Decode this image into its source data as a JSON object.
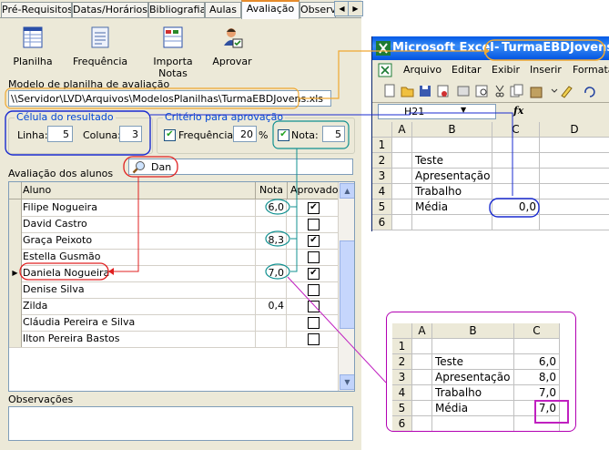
{
  "tabs": [
    "Pré-Requisitos",
    "Datas/Horários",
    "Bibliografia",
    "Aulas",
    "Avaliação",
    "Observ"
  ],
  "active_tab": "Avaliação",
  "toolbar": {
    "planilha": "Planilha",
    "frequencia": "Frequência",
    "importa_notas": "Importa Notas",
    "aprovar": "Aprovar"
  },
  "modelo": {
    "label": "Modelo de planilha de avaliação",
    "path": "\\\\Servidor\\LVD\\Arquivos\\ModelosPlanilhas\\TurmaEBDJovens.xls"
  },
  "celula": {
    "title": "Célula do resultado",
    "linha_label": "Linha:",
    "linha_value": "5",
    "coluna_label": "Coluna:",
    "coluna_value": "3"
  },
  "criterio": {
    "title": "Critério para aprovação",
    "frequencia_label": "Frequência:",
    "frequencia_value": "20",
    "percent": "%",
    "nota_label": "Nota:",
    "nota_value": "5"
  },
  "avaliacao": {
    "label": "Avaliação dos alunos",
    "search": "Dan",
    "headers": {
      "aluno": "Aluno",
      "nota": "Nota",
      "aprovado": "Aprovado"
    },
    "rows": [
      {
        "aluno": "Filipe Nogueira",
        "nota": "6,0",
        "aprovado": true
      },
      {
        "aluno": "David Castro",
        "nota": "",
        "aprovado": false
      },
      {
        "aluno": "Graça Peixoto",
        "nota": "8,3",
        "aprovado": true
      },
      {
        "aluno": "Estella Gusmão",
        "nota": "",
        "aprovado": false
      },
      {
        "aluno": "Daniela Nogueira",
        "nota": "7,0",
        "aprovado": true
      },
      {
        "aluno": "Denise Silva",
        "nota": "",
        "aprovado": false
      },
      {
        "aluno": "Zilda",
        "nota": "0,4",
        "aprovado": false
      },
      {
        "aluno": "Cláudia Pereira e Silva",
        "nota": "",
        "aprovado": false
      },
      {
        "aluno": "Ilton Pereira Bastos",
        "nota": "",
        "aprovado": false
      }
    ]
  },
  "observacoes": {
    "label": "Observações",
    "value": ""
  },
  "excel": {
    "app": "Microsoft Excel",
    "file": "TurmaEBDJovens.xls",
    "menu": [
      "Arquivo",
      "Editar",
      "Exibir",
      "Inserir",
      "Formata"
    ],
    "name_box": "H21",
    "fx": "fx",
    "columns": [
      "A",
      "B",
      "C",
      "D"
    ],
    "rows": [
      {
        "n": "1",
        "b": "",
        "c": ""
      },
      {
        "n": "2",
        "b": "Teste",
        "c": ""
      },
      {
        "n": "3",
        "b": "Apresentação",
        "c": ""
      },
      {
        "n": "4",
        "b": "Trabalho",
        "c": ""
      },
      {
        "n": "5",
        "b": "Média",
        "c": "0,0"
      },
      {
        "n": "6",
        "b": "",
        "c": ""
      }
    ]
  },
  "callout_sheet": {
    "columns": [
      "A",
      "B",
      "C"
    ],
    "rows": [
      {
        "n": "1",
        "b": "",
        "c": ""
      },
      {
        "n": "2",
        "b": "Teste",
        "c": "6,0"
      },
      {
        "n": "3",
        "b": "Apresentação",
        "c": "8,0"
      },
      {
        "n": "4",
        "b": "Trabalho",
        "c": "7,0"
      },
      {
        "n": "5",
        "b": "Média",
        "c": "7,0"
      },
      {
        "n": "6",
        "b": "",
        "c": ""
      }
    ]
  },
  "colors": {
    "orange": "#f0a830",
    "blue": "#1a2bd0",
    "teal": "#109090",
    "red": "#e02020",
    "magenta": "#c020c0"
  }
}
